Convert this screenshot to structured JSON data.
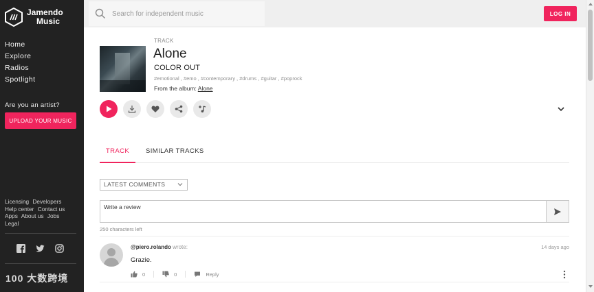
{
  "brand": {
    "line1": "Jamendo",
    "line2": "Music"
  },
  "nav": [
    {
      "label": "Home"
    },
    {
      "label": "Explore"
    },
    {
      "label": "Radios"
    },
    {
      "label": "Spotlight"
    }
  ],
  "artist_cta": {
    "question": "Are you an artist?",
    "button": "UPLOAD YOUR MUSIC"
  },
  "footer_links": [
    "Licensing",
    "Developers",
    "Help center",
    "Contact us",
    "Apps",
    "About us",
    "Jobs",
    "Legal"
  ],
  "social_icons": [
    "facebook-icon",
    "twitter-icon",
    "instagram-icon"
  ],
  "watermark": "100 大数跨境",
  "search": {
    "placeholder": "Search for independent music"
  },
  "login": "LOG IN",
  "track": {
    "kind": "TRACK",
    "title": "Alone",
    "artist": "COLOR OUT",
    "tags": "#emotional , #emo , #contemporary , #drums , #guitar , #poprock",
    "album_prefix": "From the album:",
    "album": "Alone"
  },
  "actions": [
    "play-icon",
    "download-icon",
    "heart-icon",
    "share-icon",
    "add-to-playlist-icon"
  ],
  "tabs": [
    {
      "label": "TRACK",
      "active": true
    },
    {
      "label": "SIMILAR TRACKS",
      "active": false
    }
  ],
  "comments": {
    "sort_label": "LATEST COMMENTS",
    "review_placeholder": "Write a review",
    "chars_left": "250 characters left",
    "items": [
      {
        "user": "@piero.rolando",
        "verb": "wrote:",
        "time": "14 days ago",
        "text": "Grazie.",
        "likes": "0",
        "dislikes": "0",
        "reply": "Reply"
      }
    ]
  },
  "colors": {
    "accent": "#f0245d",
    "sidebar": "#222222",
    "topbar": "#efefef"
  }
}
